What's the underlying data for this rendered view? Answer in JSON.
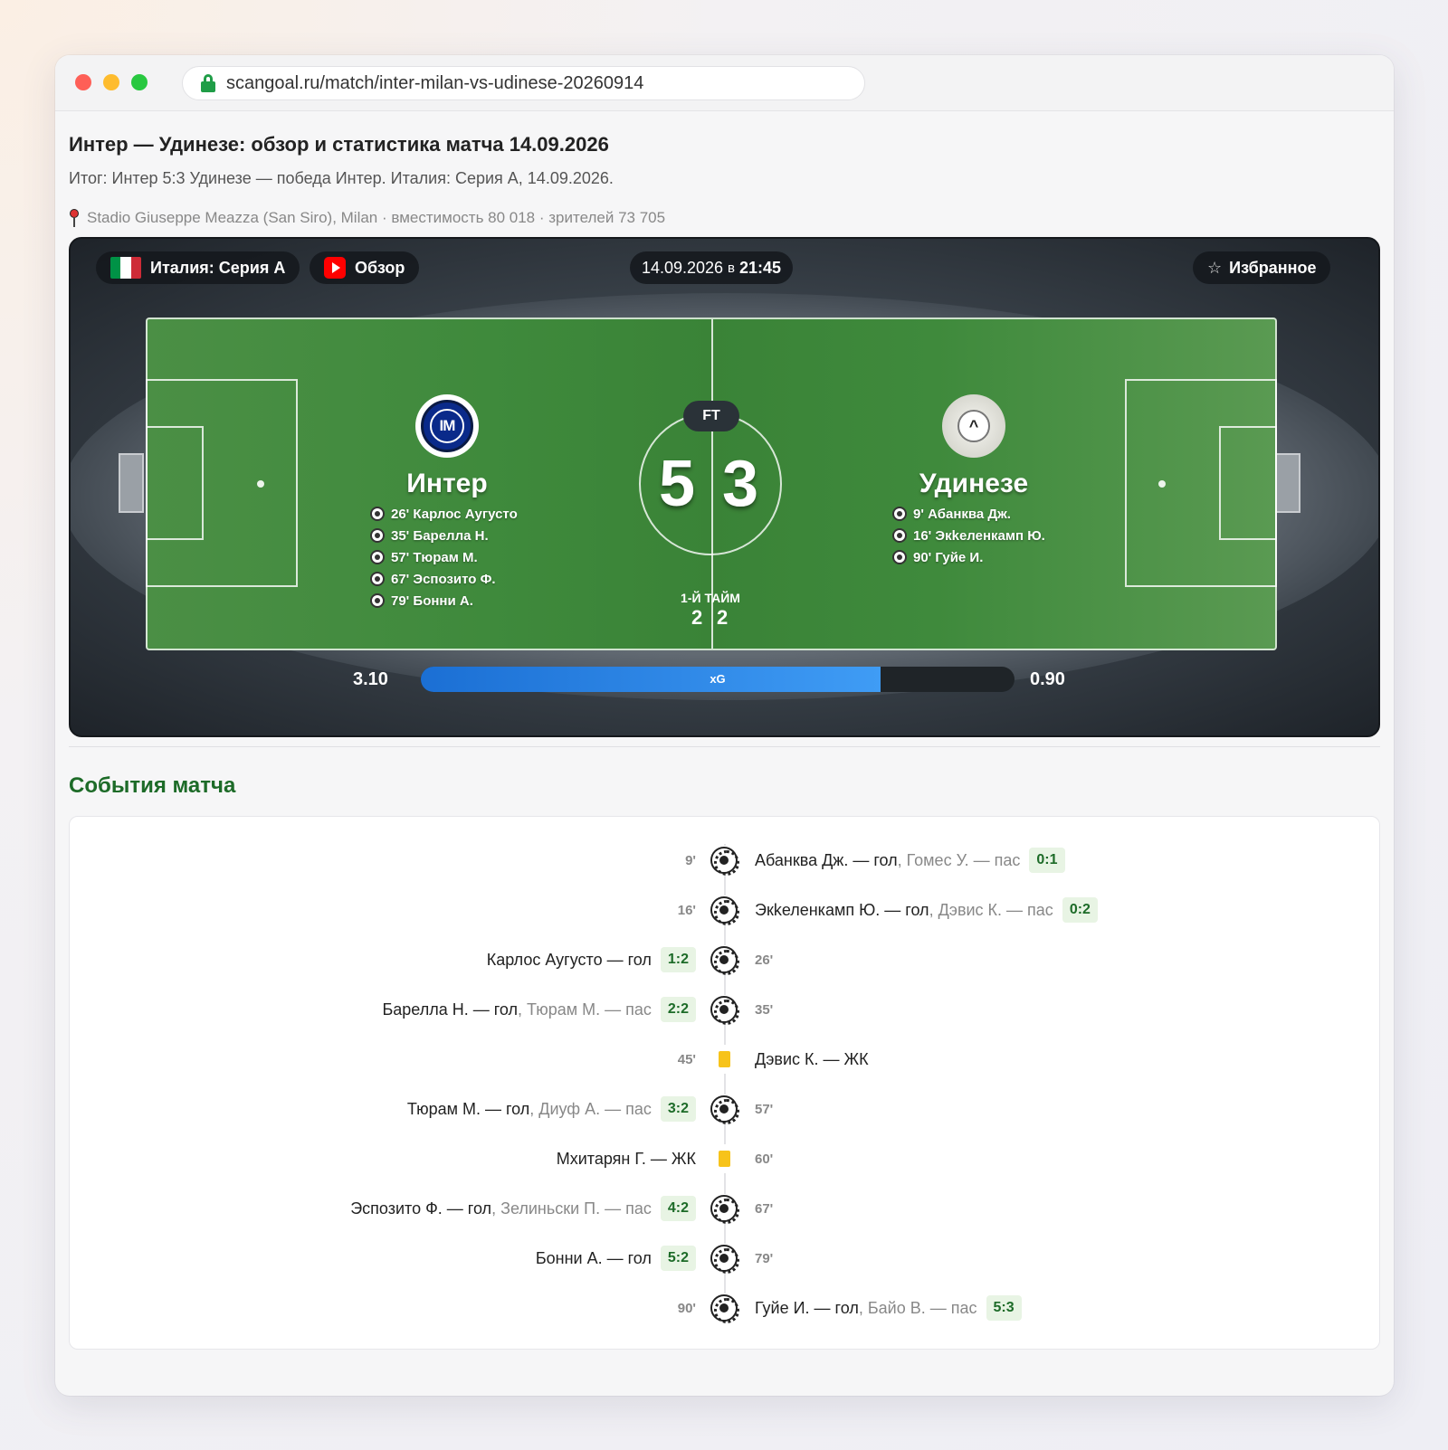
{
  "browser": {
    "url": "scangoal.ru/match/inter-milan-vs-udinese-20260914"
  },
  "page": {
    "title": "Интер — Удинезе: обзор и статистика матча 14.09.2026",
    "subtitle": "Итог: Интер 5:3 Удинезе — победа Интер. Италия: Серия А, 14.09.2026.",
    "venue": "Stadio Giuseppe Meazza (San Siro), Milan · вместимость 80 018 · зрителей 73 705"
  },
  "match": {
    "league_label": "Италия: Серия А",
    "review_label": "Обзор",
    "date": "14.09.2026",
    "date_sep": "в",
    "time": "21:45",
    "favorite_label": "Избранное",
    "status": "FT",
    "home": {
      "name": "Интер",
      "score": "5",
      "half_score": "2",
      "xg": "3.10",
      "scorers": [
        "26' Карлос Аугусто",
        "35' Барелла Н.",
        "57' Тюрам М.",
        "67' Эспозито Ф.",
        "79' Бонни А."
      ]
    },
    "away": {
      "name": "Удинезе",
      "score": "3",
      "half_score": "2",
      "xg": "0.90",
      "scorers": [
        "9'  Абанква Дж.",
        "16' Экkеленкамп Ю.",
        "90' Гуйе И."
      ]
    },
    "half_label": "1-Й ТАЙМ",
    "xg_label": "xG",
    "xg_home_share": 0.775
  },
  "events": {
    "title": "События матча",
    "items": [
      {
        "side": "right",
        "minute": "9'",
        "type": "goal",
        "text": "Абанква Дж. — гол",
        "assist": ", Гомес У. — пас",
        "score": "0:1"
      },
      {
        "side": "right",
        "minute": "16'",
        "type": "goal",
        "text": "Экkеленкамп Ю. — гол",
        "assist": ", Дэвис К. — пас",
        "score": "0:2"
      },
      {
        "side": "left",
        "minute": "26'",
        "type": "goal",
        "text": "Карлос Аугусто — гол",
        "assist": "",
        "score": "1:2"
      },
      {
        "side": "left",
        "minute": "35'",
        "type": "goal",
        "text": "Барелла Н. — гол",
        "assist": ", Тюрам М. — пас",
        "score": "2:2"
      },
      {
        "side": "right",
        "minute": "45'",
        "type": "yellow",
        "text": "Дэвис К. — ЖК",
        "assist": "",
        "score": ""
      },
      {
        "side": "left",
        "minute": "57'",
        "type": "goal",
        "text": "Тюрам М. — гол",
        "assist": ", Диуф А. — пас",
        "score": "3:2"
      },
      {
        "side": "left",
        "minute": "60'",
        "type": "yellow",
        "text": "Мхитарян Г. — ЖК",
        "assist": "",
        "score": ""
      },
      {
        "side": "left",
        "minute": "67'",
        "type": "goal",
        "text": "Эспозито Ф. — гол",
        "assist": ", Зелиньски П. — пас",
        "score": "4:2"
      },
      {
        "side": "left",
        "minute": "79'",
        "type": "goal",
        "text": "Бонни А. — гол",
        "assist": "",
        "score": "5:2"
      },
      {
        "side": "right",
        "minute": "90'",
        "type": "goal",
        "text": "Гуйе И. — гол",
        "assist": ", Байо В. — пас",
        "score": "5:3"
      }
    ]
  },
  "colors": {
    "accent_green": "#1d6b28",
    "xg_blue": "#1b6fd4",
    "yellow_card": "#f7c31a",
    "italy_flag": [
      "#009246",
      "#ffffff",
      "#ce2b37"
    ]
  }
}
